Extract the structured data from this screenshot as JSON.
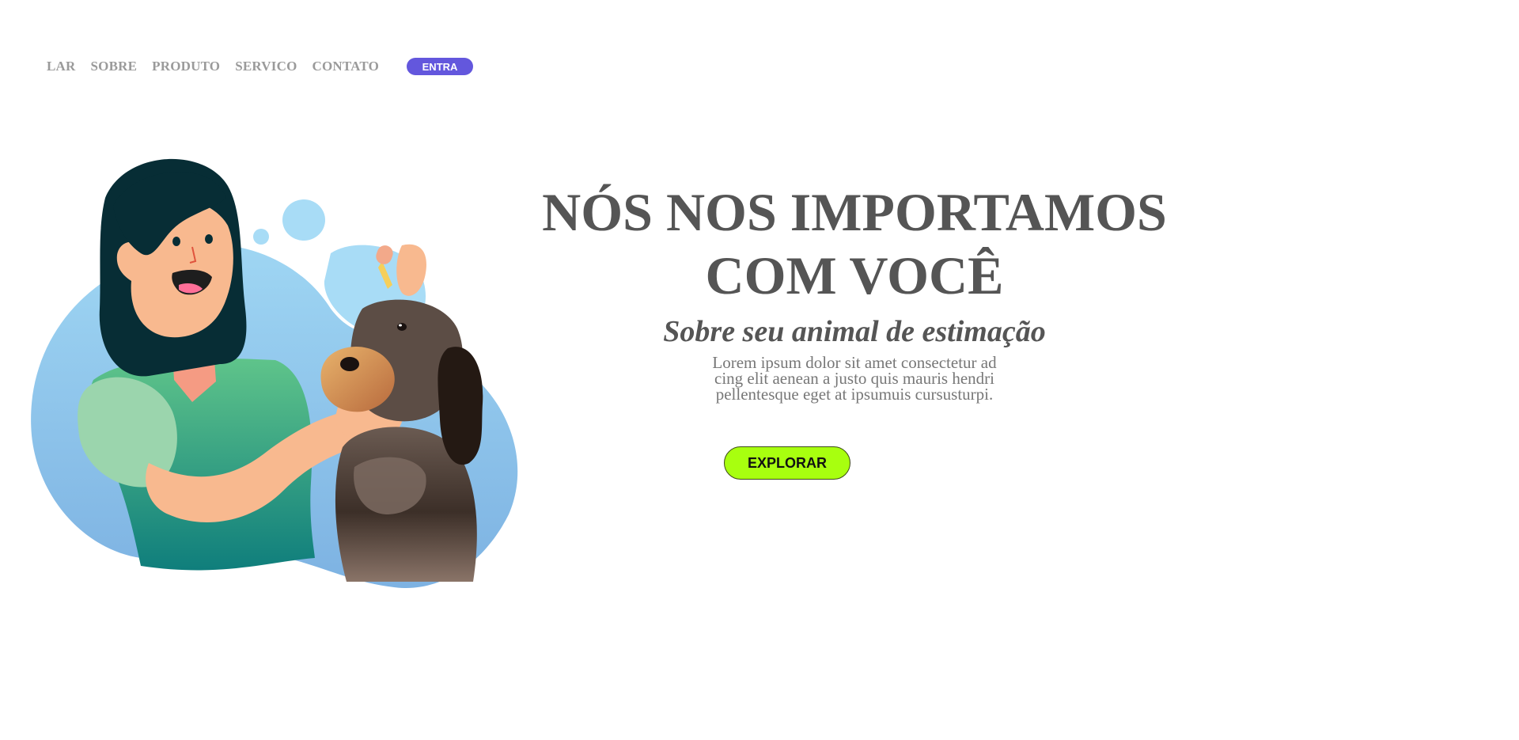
{
  "nav": {
    "links": [
      "LAR",
      "SOBRE",
      "PRODUTO",
      "SERVICO",
      "CONTATO"
    ],
    "cta_label": "ENTRA",
    "cta_color": "#6357dd"
  },
  "hero": {
    "headline_line1": "NÓS NOS IMPORTAMOS",
    "headline_line2": "COM VOCÊ",
    "subheadline": "Sobre seu animal de estimação",
    "description": "Lorem ipsum dolor sit amet consectetur ad cing elit aenean a justo quis mauris hendri pellentesque eget at ipsumuis cursusturpi.",
    "button_label": "EXPLORAR",
    "button_color": "#a8ff0f",
    "illustration": "woman-giving-ear-drops-to-dog-illustration"
  },
  "colors": {
    "text_primary": "#555555",
    "text_muted": "#777777",
    "nav_text": "#9a9a9a"
  }
}
